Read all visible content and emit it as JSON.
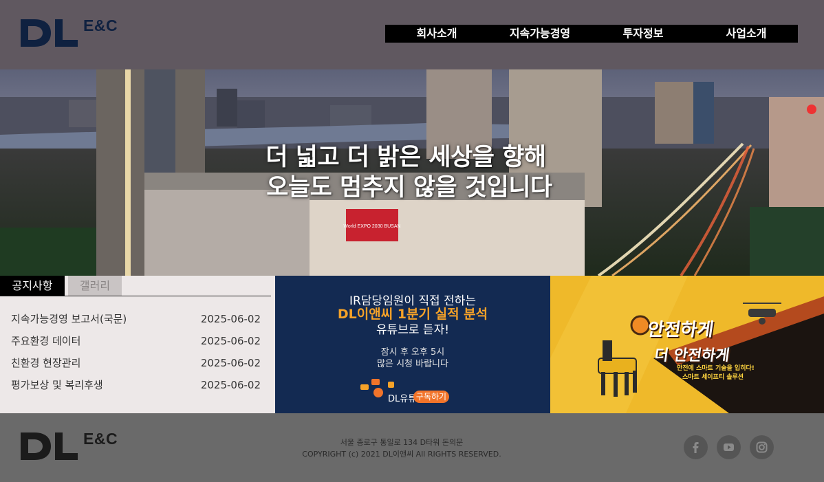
{
  "brand": {
    "logo_text": "DL",
    "logo_suffix": "E&C"
  },
  "nav": {
    "items": [
      {
        "label": "회사소개"
      },
      {
        "label": "지속가능경영"
      },
      {
        "label": "투자정보"
      },
      {
        "label": "사업소개"
      }
    ]
  },
  "hero": {
    "line1": "더 넓고 더 밝은 세상을 향해",
    "line2": "오늘도 멈추지 않을 것입니다",
    "billboard_text": "World EXPO 2030 BUSAN"
  },
  "notice": {
    "tabs": [
      {
        "label": "공지사항",
        "active": true
      },
      {
        "label": "갤러리",
        "active": false
      }
    ],
    "items": [
      {
        "title": "지속가능경영 보고서(국문)",
        "date": "2025-06-02"
      },
      {
        "title": "주요환경 데이터",
        "date": "2025-06-02"
      },
      {
        "title": "친환경 현장관리",
        "date": "2025-06-02"
      },
      {
        "title": "평가보상 및 복리후생",
        "date": "2025-06-02"
      }
    ]
  },
  "banner_ir": {
    "line1": "IR담당임원이 직접 전하는",
    "line2": "DL이앤씨 1분기 실적 분석",
    "line3": "유튜브로 듣자!",
    "line4": "잠시 후 오후 5시",
    "line5": "많은 시청 바랍니다",
    "channel_label": "DL유튜브",
    "subscribe_label": "구독하기"
  },
  "banner_safety": {
    "line1": "안전하게",
    "line2": "더 안전하게",
    "line3": "안전에 스마트 기술을 입히다!",
    "line4": "스마트 세이프티 솔루션"
  },
  "footer": {
    "address": "서울 종로구 통일로 134 D타워 돈의문",
    "copyright": "COPYRIGHT (c) 2021 DL이앤씨 All RIGHTS RESERVED.",
    "social": [
      {
        "icon": "facebook-icon"
      },
      {
        "icon": "youtube-icon"
      },
      {
        "icon": "instagram-icon"
      }
    ]
  },
  "colors": {
    "header_bg": "#605860",
    "nav_bg": "#000000",
    "logo_navy": "#0f2140",
    "notice_bg": "#ede8e8",
    "ir_banner_bg": "#132a52",
    "ir_accent": "#f6a228",
    "safety_banner_bg": "#efb92a",
    "footer_bg": "#6a6a6a"
  }
}
